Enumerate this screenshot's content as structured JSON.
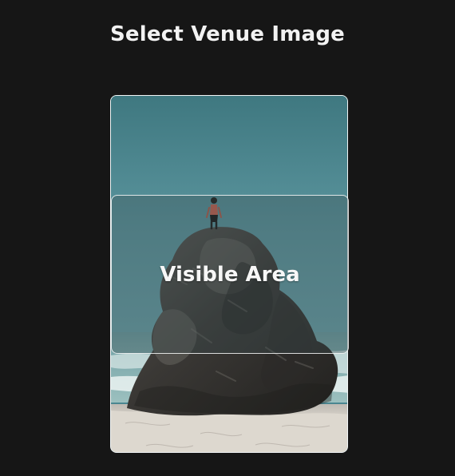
{
  "header": {
    "title": "Select Venue Image"
  },
  "crop": {
    "label": "Visible Area"
  },
  "colors": {
    "background": "#161616",
    "sky_top": "#3f7880",
    "sky_bottom": "#5f9da6",
    "rock": "#3c3a37",
    "sand": "#d8d3ca",
    "border": "#ffffff"
  },
  "image": {
    "subject": "person standing on top of a sea rock",
    "icon": "image-photo"
  }
}
